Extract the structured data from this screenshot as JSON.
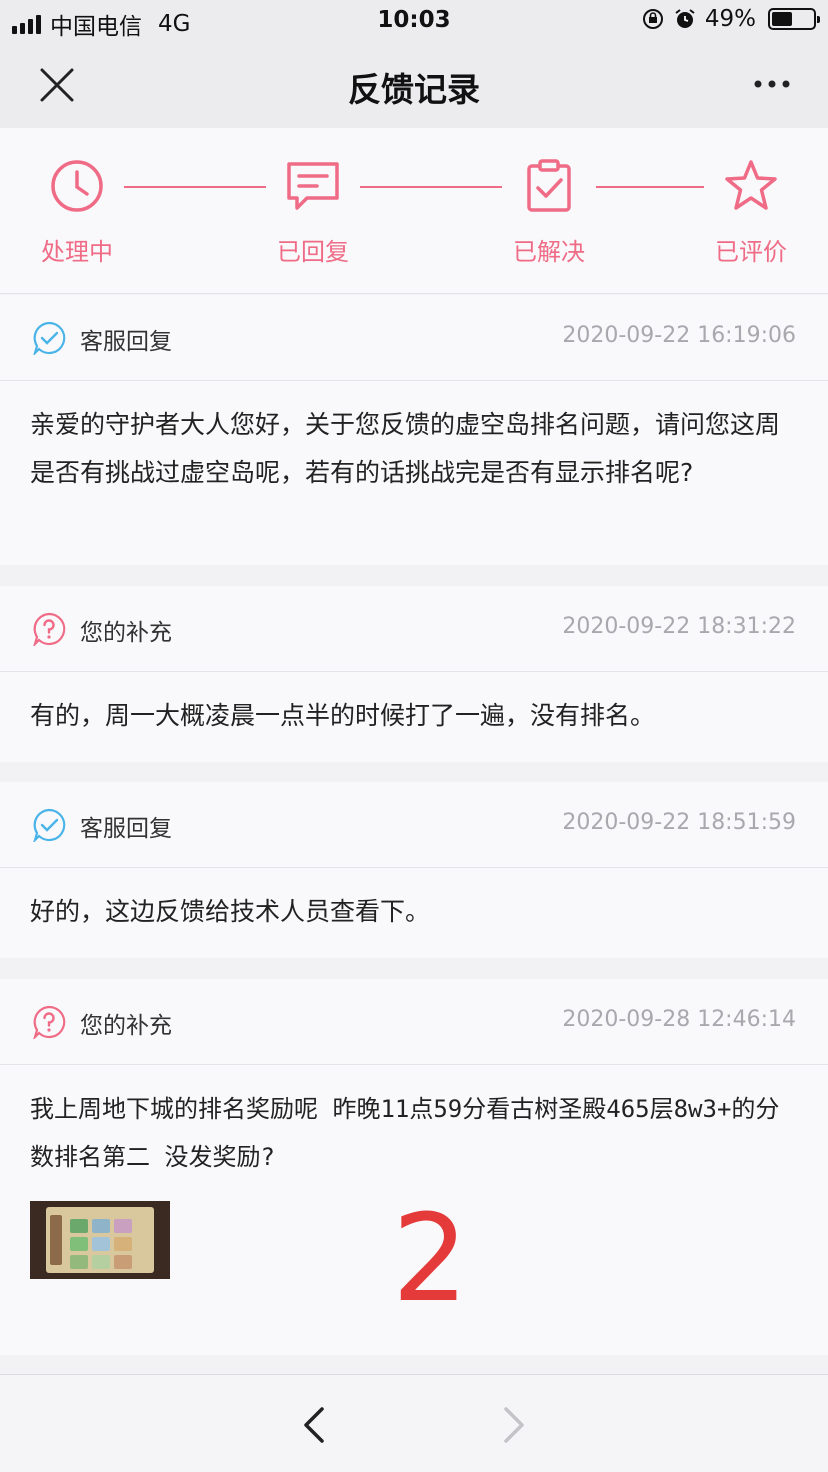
{
  "status_bar": {
    "carrier": "中国电信",
    "network": "4G",
    "time": "10:03",
    "battery": "49%",
    "battery_level": 0.49
  },
  "nav": {
    "title": "反馈记录",
    "close_icon": "close-icon",
    "more_icon": "more-icon"
  },
  "steps": [
    {
      "label": "处理中",
      "icon": "clock-icon"
    },
    {
      "label": "已回复",
      "icon": "message-icon"
    },
    {
      "label": "已解决",
      "icon": "clipboard-check-icon"
    },
    {
      "label": "已评价",
      "icon": "star-icon"
    }
  ],
  "messages": [
    {
      "author": "客服回复",
      "icon": "check-bubble-icon",
      "time": "2020-09-22 16:19:06",
      "text": "亲爱的守护者大人您好，关于您反馈的虚空岛排名问题，请问您这周是否有挑战过虚空岛呢，若有的话挑战完是否有显示排名呢?"
    },
    {
      "author": "您的补充",
      "icon": "question-bubble-icon",
      "time": "2020-09-22 18:31:22",
      "text": "有的，周一大概凌晨一点半的时候打了一遍，没有排名。"
    },
    {
      "author": "客服回复",
      "icon": "check-bubble-icon",
      "time": "2020-09-22 18:51:59",
      "text": "好的，这边反馈给技术人员查看下。"
    },
    {
      "author": "您的补充",
      "icon": "question-bubble-icon",
      "time": "2020-09-28 12:46:14",
      "text": "我上周地下城的排名奖励呢 昨晚11点59分看古树圣殿465层8w3+的分数排名第二 没发奖励?",
      "overlay_mark": "2"
    }
  ],
  "colors": {
    "accent": "#ef6b86",
    "service_icon": "#4ab3e8",
    "mark": "#e43a3a"
  }
}
